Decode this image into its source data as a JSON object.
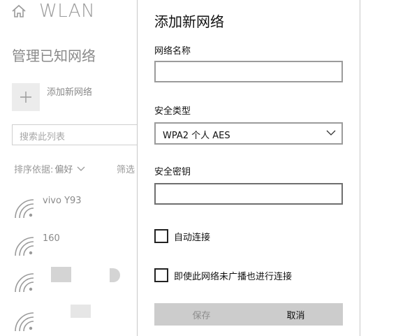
{
  "settings": {
    "title": "WLAN",
    "section_title": "管理已知网络",
    "add_network_label": "添加新网络",
    "search_placeholder": "搜索此列表",
    "sort_label": "排序依据:",
    "sort_value": "偏好",
    "filter_label": "筛选",
    "networks": [
      {
        "name": "vivo Y93"
      },
      {
        "name": "160"
      },
      {
        "name": ""
      },
      {
        "name": ""
      }
    ]
  },
  "dialog": {
    "title": "添加新网络",
    "network_name_label": "网络名称",
    "network_name_value": "",
    "security_type_label": "安全类型",
    "security_type_value": "WPA2 个人 AES",
    "security_key_label": "安全密钥",
    "security_key_value": "",
    "auto_connect_label": "自动连接",
    "auto_connect_checked": false,
    "connect_hidden_label": "即使此网络未广播也进行连接",
    "connect_hidden_checked": false,
    "save_label": "保存",
    "cancel_label": "取消"
  },
  "colors": {
    "button_gray": "#cccccc",
    "muted_text": "#8a8a8a"
  }
}
